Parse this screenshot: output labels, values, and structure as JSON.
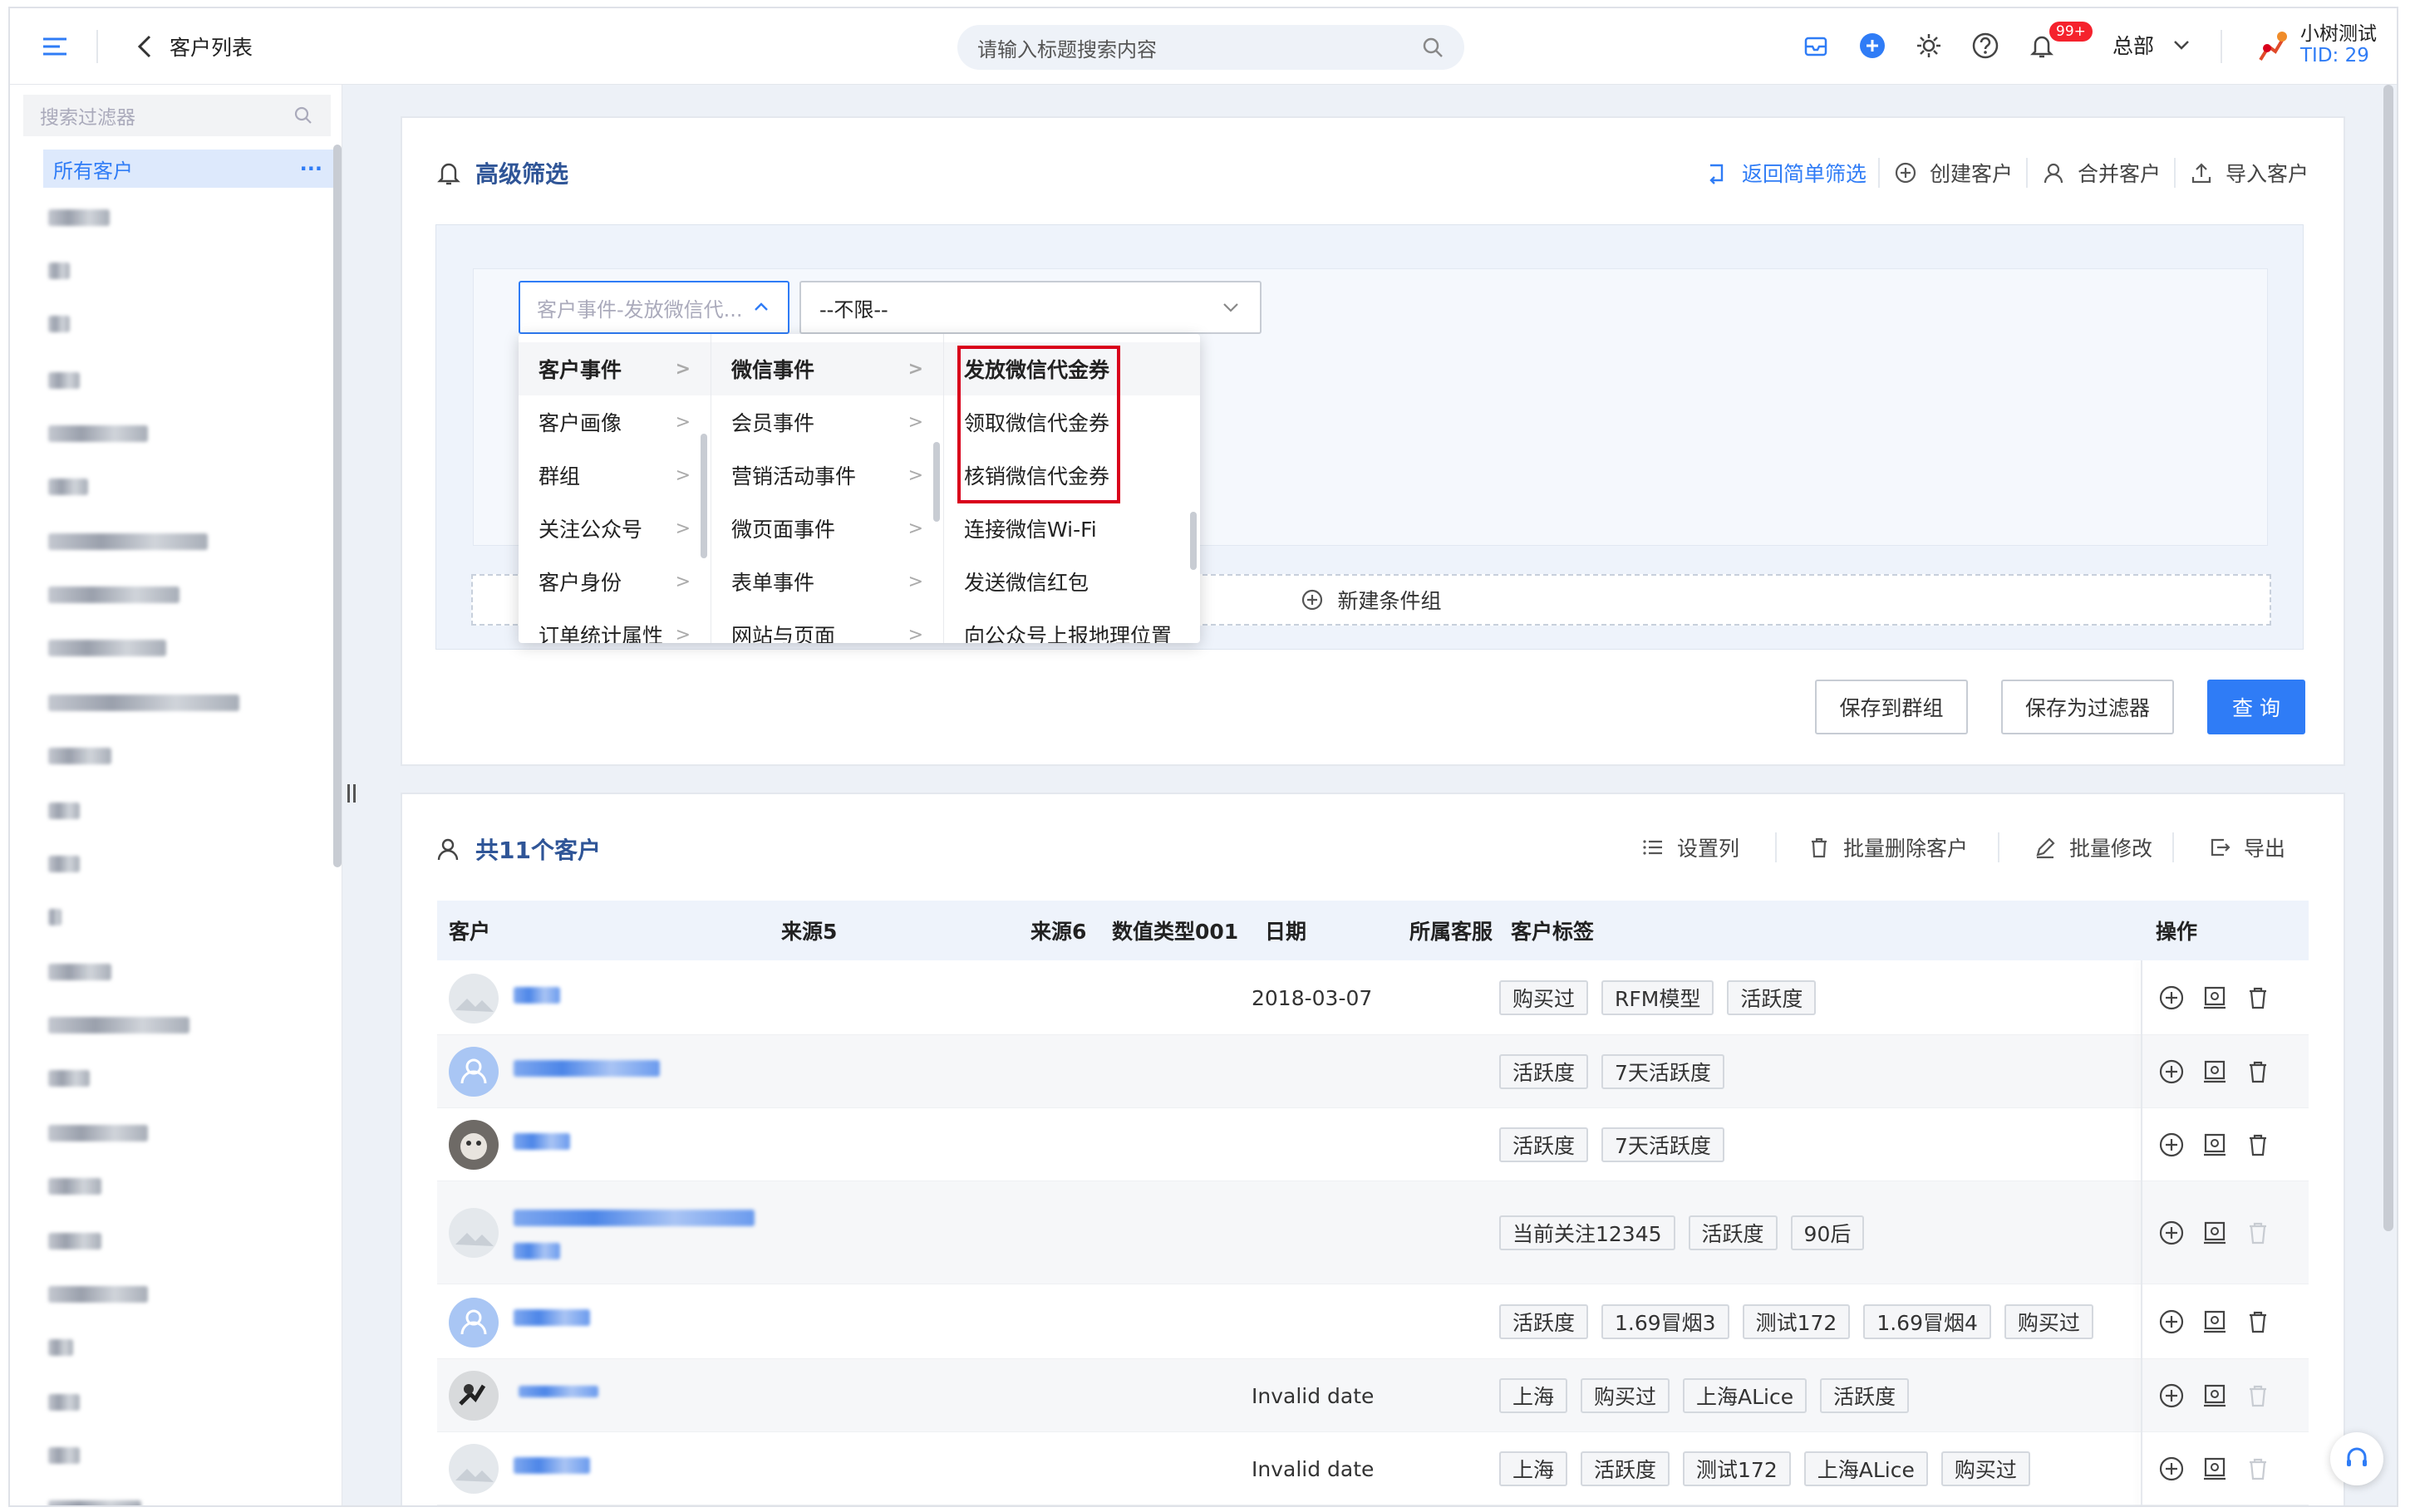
{
  "topbar": {
    "back_label": "客户列表",
    "search_placeholder": "请输入标题搜索内容",
    "notification_badge": "99+",
    "org_label": "总部",
    "user_name": "小树测试",
    "user_tid": "TID: 29"
  },
  "sidebar": {
    "search_placeholder": "搜索过滤器",
    "active_item": "所有客户",
    "more": "···"
  },
  "filter_card": {
    "title": "高级筛选",
    "actions": {
      "back_simple": "返回简单筛选",
      "create": "创建客户",
      "merge": "合并客户",
      "import": "导入客户"
    },
    "field_select_value": "客户事件-发放微信代...",
    "condition_select_value": "--不限--",
    "new_group": "新建条件组",
    "save_group": "保存到群组",
    "save_filter": "保存为过滤器",
    "query": "查 询"
  },
  "cascader": {
    "level1": [
      "客户事件",
      "客户画像",
      "群组",
      "关注公众号",
      "客户身份",
      "订单统计属性"
    ],
    "level2": [
      "微信事件",
      "会员事件",
      "营销活动事件",
      "微页面事件",
      "表单事件",
      "网站与页面"
    ],
    "level3": [
      "发放微信代金券",
      "领取微信代金券",
      "核销微信代金券",
      "连接微信Wi-Fi",
      "发送微信红包",
      "向公众号上报地理位置"
    ]
  },
  "list_card": {
    "title": "共11个客户",
    "actions": {
      "columns": "设置列",
      "batch_delete": "批量删除客户",
      "batch_edit": "批量修改",
      "export": "导出"
    },
    "columns": [
      "客户",
      "来源5",
      "来源6",
      "数值类型001",
      "日期",
      "所属客服",
      "客户标签",
      "操作"
    ],
    "rows": [
      {
        "date": "2018-03-07",
        "tags": [
          "购买过",
          "RFM模型",
          "活跃度"
        ]
      },
      {
        "date": "",
        "tags": [
          "活跃度",
          "7天活跃度"
        ]
      },
      {
        "date": "",
        "tags": [
          "活跃度",
          "7天活跃度"
        ]
      },
      {
        "date": "",
        "tags": [
          "当前关注12345",
          "活跃度",
          "90后"
        ]
      },
      {
        "date": "",
        "tags": [
          "活跃度",
          "1.69冒烟3",
          "测试172",
          "1.69冒烟4",
          "购买过"
        ]
      },
      {
        "date": "Invalid date",
        "tags": [
          "上海",
          "购买过",
          "上海ALice",
          "活跃度"
        ]
      },
      {
        "date": "Invalid date",
        "tags": [
          "上海",
          "活跃度",
          "测试172",
          "上海ALice",
          "购买过"
        ]
      }
    ]
  },
  "colors": {
    "accent": "#2f7cf6",
    "highlight_box": "#d9001b",
    "badge": "#f5222d"
  }
}
